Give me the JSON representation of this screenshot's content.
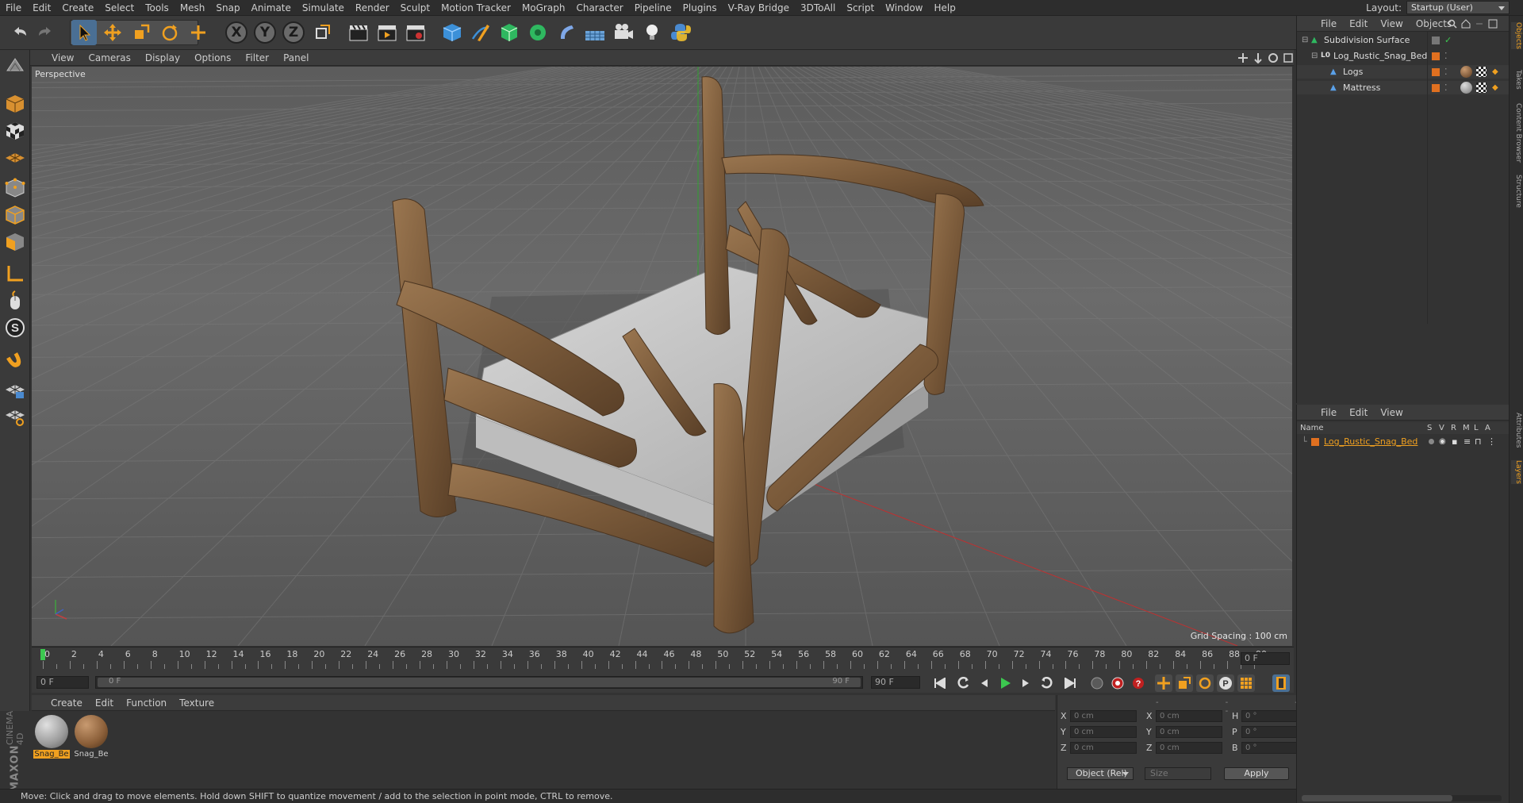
{
  "menubar": {
    "items": [
      "File",
      "Edit",
      "Create",
      "Select",
      "Tools",
      "Mesh",
      "Snap",
      "Animate",
      "Simulate",
      "Render",
      "Sculpt",
      "Motion Tracker",
      "MoGraph",
      "Character",
      "Pipeline",
      "Plugins",
      "V-Ray Bridge",
      "3DToAll",
      "Script",
      "Window",
      "Help"
    ],
    "layout_label": "Layout:",
    "layout_value": "Startup (User)"
  },
  "viewport": {
    "menu": [
      "View",
      "Cameras",
      "Display",
      "Options",
      "Filter",
      "Panel"
    ],
    "camera_label": "Perspective",
    "grid_spacing": "Grid Spacing : 100 cm"
  },
  "timeline": {
    "ticks": [
      "0",
      "2",
      "4",
      "6",
      "8",
      "10",
      "12",
      "14",
      "16",
      "18",
      "20",
      "22",
      "24",
      "26",
      "28",
      "30",
      "32",
      "34",
      "36",
      "38",
      "40",
      "42",
      "44",
      "46",
      "48",
      "50",
      "52",
      "54",
      "56",
      "58",
      "60",
      "62",
      "64",
      "66",
      "68",
      "70",
      "72",
      "74",
      "76",
      "78",
      "80",
      "82",
      "84",
      "86",
      "88",
      "90"
    ],
    "current_frame": "0 F",
    "start_field": "0 F",
    "range_start": "0 F",
    "range_end": "90 F",
    "end_field": "90 F"
  },
  "materials": {
    "menu": [
      "Create",
      "Edit",
      "Function",
      "Texture"
    ],
    "items": [
      {
        "name": "Snag_Be",
        "selected": true
      },
      {
        "name": "Snag_Be",
        "selected": false
      }
    ]
  },
  "coords": {
    "rows": [
      {
        "a": "X",
        "av": "0 cm",
        "b": "X",
        "bv": "0 cm",
        "c": "H",
        "cv": "0 °"
      },
      {
        "a": "Y",
        "av": "0 cm",
        "b": "Y",
        "bv": "0 cm",
        "c": "P",
        "cv": "0 °"
      },
      {
        "a": "Z",
        "av": "0 cm",
        "b": "Z",
        "bv": "0 cm",
        "c": "B",
        "cv": "0 °"
      }
    ],
    "mode": "Object (Rel)",
    "size": "Size",
    "apply": "Apply",
    "headers": [
      "--",
      "--",
      "--"
    ]
  },
  "objects": {
    "menu": [
      "File",
      "Edit",
      "View",
      "Objects"
    ],
    "tree": [
      {
        "name": "Subdivision Surface",
        "indent": 0
      },
      {
        "name": "Log_Rustic_Snag_Bed",
        "indent": 1
      },
      {
        "name": "Logs",
        "indent": 2
      },
      {
        "name": "Mattress",
        "indent": 2
      }
    ]
  },
  "layers": {
    "menu": [
      "File",
      "Edit",
      "View"
    ],
    "columns": [
      "Name",
      "S",
      "V",
      "R",
      "M",
      "L",
      "A"
    ],
    "rows": [
      {
        "name": "Log_Rustic_Snag_Bed"
      }
    ]
  },
  "right_tabs": [
    "Objects",
    "Takes",
    "Content Browser",
    "Structure",
    "Attributes",
    "Layers"
  ],
  "status": "Move: Click and drag to move elements. Hold down SHIFT to quantize movement / add to the selection in point mode, CTRL to remove.",
  "brand": {
    "line1": "MAXON",
    "line2": "CINEMA 4D"
  },
  "colors": {
    "accent": "#f0a020",
    "active_icon": "#4aa0e8"
  }
}
